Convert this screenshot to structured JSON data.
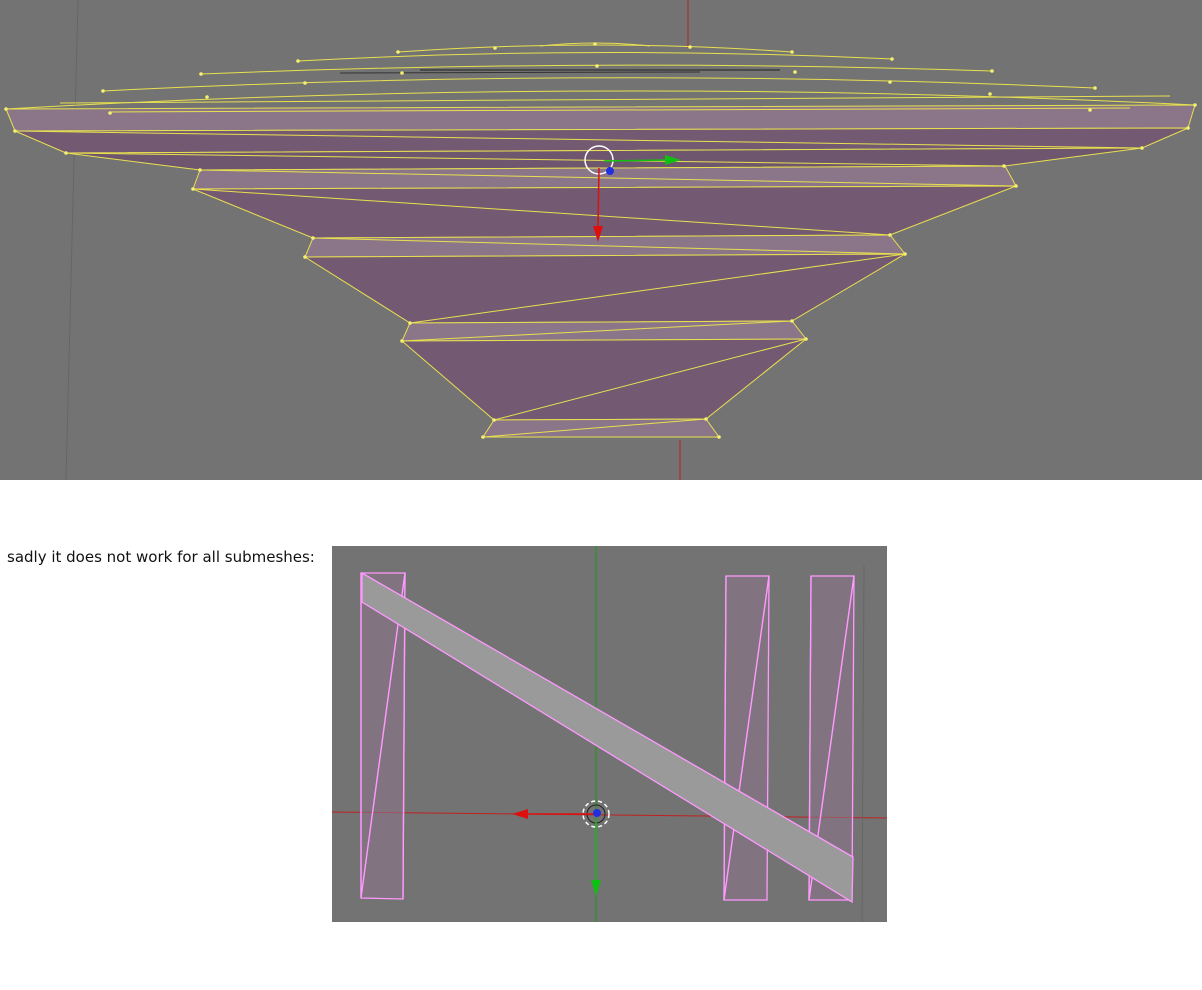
{
  "caption": "sadly it does not work for all submeshes:",
  "colors": {
    "viewport_bg": "#737373",
    "mesh_face": "#735a72",
    "mesh_face_light": "#8b7589",
    "edge_selected": "#e8e050",
    "vertex_selected": "#f5f070",
    "edge_pink": "#ff99ff",
    "band_fill": "#9a9a9a",
    "axis_x": "#dd1010",
    "axis_y": "#10c010",
    "axis_z": "#2030e0"
  },
  "icons": {
    "cursor_top": "3d-cursor-icon",
    "cursor_bottom": "3d-cursor-icon",
    "gizmo_top": "transform-gizmo-icon",
    "gizmo_bottom": "transform-gizmo-icon"
  }
}
